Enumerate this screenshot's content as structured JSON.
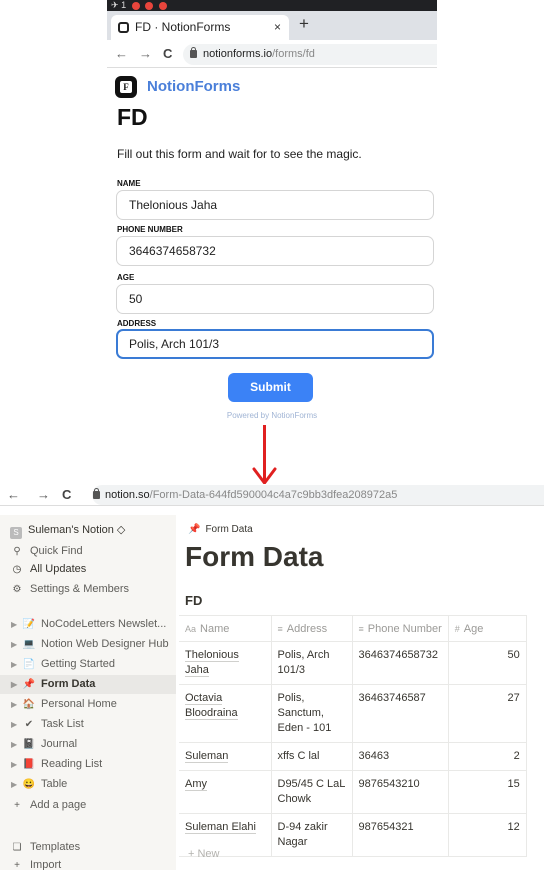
{
  "top_browser": {
    "os_indicator": "1",
    "tab_title": "FD · NotionForms",
    "tab_close": "×",
    "new_tab": "+",
    "back": "←",
    "forward": "→",
    "reload": "C",
    "url_domain": "notionforms.io",
    "url_path": "/forms/fd"
  },
  "form": {
    "brand_logo_letter": "F",
    "brand": "NotionForms",
    "title": "FD",
    "description": "Fill out this form and wait for to see the magic.",
    "fields": [
      {
        "label": "NAME",
        "value": "Thelonious Jaha"
      },
      {
        "label": "PHONE NUMBER",
        "value": "3646374658732"
      },
      {
        "label": "AGE",
        "value": "50"
      },
      {
        "label": "ADDRESS",
        "value": "Polis, Arch 101/3"
      }
    ],
    "submit_label": "Submit",
    "powered_by": "Powered by NotionForms"
  },
  "bottom_browser": {
    "back": "←",
    "forward": "→",
    "reload": "C",
    "url_domain": "notion.so",
    "url_path": "/Form-Data-644fd590004c4a7c9bb3dfea208972a5"
  },
  "sidebar": {
    "workspace_icon": "S",
    "workspace": "Suleman's Notion ◇",
    "quick_find": "Quick Find",
    "all_updates": "All Updates",
    "settings": "Settings & Members",
    "pages": [
      {
        "label": "NoCodeLetters Newslet...",
        "icon": "📝"
      },
      {
        "label": "Notion Web Designer Hub",
        "icon": "💻"
      },
      {
        "label": "Getting Started",
        "icon": "📄"
      },
      {
        "label": "Form Data",
        "icon": "📌"
      },
      {
        "label": "Personal Home",
        "icon": "🏠"
      },
      {
        "label": "Task List",
        "icon": "✔"
      },
      {
        "label": "Journal",
        "icon": "📓"
      },
      {
        "label": "Reading List",
        "icon": "📕"
      },
      {
        "label": "Table",
        "icon": "😀"
      }
    ],
    "add_page": "Add a page",
    "templates": "Templates",
    "import": "Import"
  },
  "main": {
    "breadcrumb": "Form Data",
    "page_title": "Form Data",
    "db_title": "FD",
    "columns": [
      {
        "icon": "Aa",
        "label": "Name"
      },
      {
        "icon": "≡",
        "label": "Address"
      },
      {
        "icon": "≡",
        "label": "Phone Number"
      },
      {
        "icon": "#",
        "label": "Age"
      }
    ],
    "rows": [
      [
        "Thelonious Jaha",
        "Polis, Arch 101/3",
        "3646374658732",
        "50"
      ],
      [
        "Octavia Bloodraina",
        "Polis, Sanctum, Eden - 101",
        "36463746587",
        "27"
      ],
      [
        "Suleman",
        "xffs C lal",
        "36463",
        "2"
      ],
      [
        "Amy",
        "D95/45 C LaL Chowk",
        "9876543210",
        "15"
      ],
      [
        "Suleman Elahi",
        "D-94 zakir Nagar",
        "987654321",
        "12"
      ]
    ],
    "new_row": "+ New"
  },
  "colors": {
    "accent_blue": "#3b82f6",
    "arrow_red": "#e02020",
    "sidebar_bg": "#f7f6f3"
  }
}
